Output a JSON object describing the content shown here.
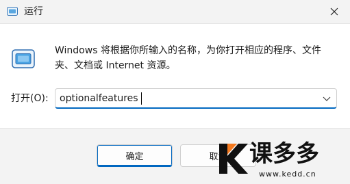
{
  "window": {
    "title": "运行",
    "close_icon": "close-icon",
    "run_icon": "run-dialog-icon"
  },
  "content": {
    "description": "Windows 将根据你所输入的名称，为你打开相应的程序、文件夹、文档或 Internet 资源。",
    "open_label": "打开(O):",
    "input_value": "optionalfeatures",
    "dropdown_icon": "chevron-down-icon"
  },
  "buttons": {
    "ok_label": "确定",
    "cancel_label": "取消"
  },
  "watermark": {
    "brand": "课多多",
    "url": "www.kedd.cn",
    "accent": "#f47a20"
  },
  "colors": {
    "accent": "#0067c0",
    "background": "#f3f3f3",
    "content": "#ffffff"
  }
}
